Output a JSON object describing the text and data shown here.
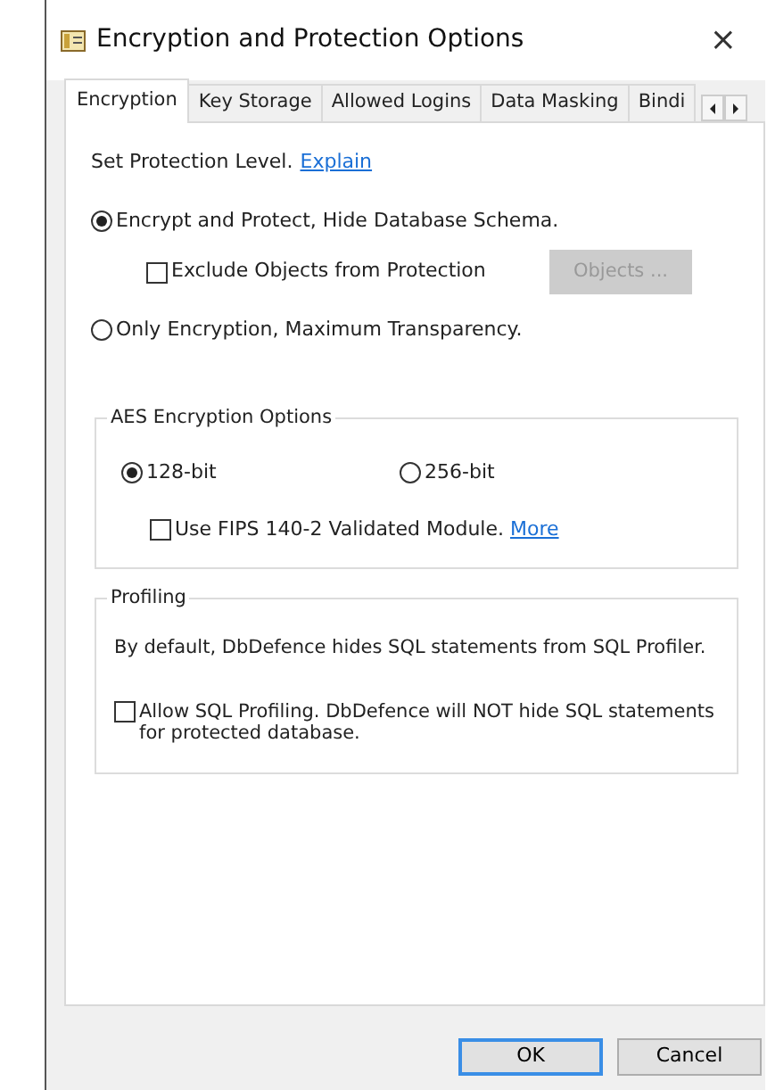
{
  "window": {
    "title": "Encryption and Protection Options",
    "close": "×"
  },
  "tabs": [
    {
      "label": "Encryption",
      "selected": true
    },
    {
      "label": "Key Storage",
      "selected": false
    },
    {
      "label": "Allowed Logins",
      "selected": false
    },
    {
      "label": "Data Masking",
      "selected": false
    },
    {
      "label": "Bindi",
      "selected": false
    }
  ],
  "protection": {
    "label": "Set Protection Level.",
    "link": "Explain",
    "options": [
      {
        "label": "Encrypt and Protect, Hide Database Schema.",
        "selected": true
      },
      {
        "label": "Only Encryption, Maximum Transparency.",
        "selected": false
      }
    ],
    "exclude": {
      "label": "Exclude Objects from Protection",
      "checked": false
    },
    "objects_button": {
      "label": "Objects ...",
      "disabled": true
    }
  },
  "aes": {
    "title": "AES Encryption Options",
    "options": [
      {
        "label": "128-bit",
        "selected": true
      },
      {
        "label": "256-bit",
        "selected": false
      }
    ],
    "fips": {
      "label": "Use FIPS 140-2 Validated Module.",
      "link": "More",
      "checked": false
    }
  },
  "profiling": {
    "title": "Profiling",
    "description": "By default, DbDefence hides SQL statements from SQL Profiler.",
    "allow": {
      "label": "Allow SQL Profiling. DbDefence will NOT hide SQL statements for protected database.",
      "checked": false
    }
  },
  "buttons": [
    {
      "label": "OK",
      "default": true
    },
    {
      "label": "Cancel",
      "default": false
    }
  ]
}
